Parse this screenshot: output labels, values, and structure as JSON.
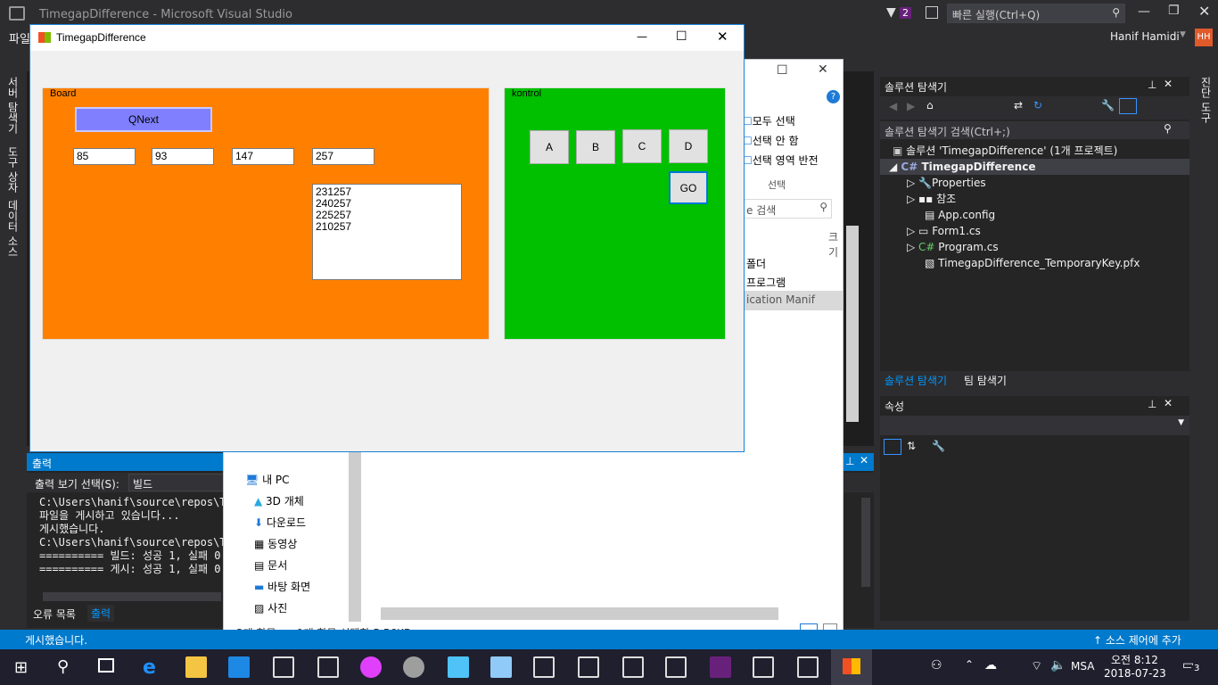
{
  "vs": {
    "title": "TimegapDifference - Microsoft Visual Studio",
    "notif_count": "2",
    "quick_launch": "빠른 실행(Ctrl+Q)",
    "menu_file": "파일",
    "user": "Hanif Hamidi",
    "user_initials": "HH",
    "left_tabs": [
      "서버 탐색기",
      "도구 상자",
      "데이터 소스"
    ],
    "right_tab": "진단 도구",
    "status": "게시했습니다.",
    "source_control": "소스 제어에 추가"
  },
  "output": {
    "title": "출력",
    "show_label": "출력 보기 선택(S):",
    "show_value": "빌드",
    "lines": [
      "C:\\Users\\hanif\\source\\repos\\Ti",
      "파일을 게시하고 있습니다...",
      "게시했습니다.",
      "C:\\Users\\hanif\\source\\repos\\Ti",
      "========== 빌드: 성공 1, 실패 0",
      "========== 게시: 성공 1, 실패 0"
    ],
    "tab_errors": "오류 목록",
    "tab_output": "출력"
  },
  "solution": {
    "title": "솔루션 탐색기",
    "search": "솔루션 탐색기 검색(Ctrl+;)",
    "items": [
      "솔루션 'TimegapDifference' (1개 프로젝트)",
      "TimegapDifference",
      "Properties",
      "참조",
      "App.config",
      "Form1.cs",
      "Program.cs",
      "TimegapDifference_TemporaryKey.pfx"
    ],
    "tab_solution": "솔루션 탐색기",
    "tab_team": "팀 탐색기"
  },
  "properties": {
    "title": "속성"
  },
  "explorer": {
    "select_all": "모두 선택",
    "select_none": "선택 안 함",
    "invert": "선택 영역 반전",
    "group_label": "선택",
    "search": "e 검색",
    "col_size": "크기",
    "rows": [
      "폴더",
      "프로그램",
      "ication Manif"
    ],
    "nav": [
      "내 PC",
      "3D 개체",
      "다운로드",
      "동영상",
      "문서",
      "바탕 화면",
      "사진"
    ],
    "status_count": "3개 항목",
    "status_sel": "1개 항목 선택함 5.56KB"
  },
  "form": {
    "title": "TimegapDifference",
    "board_label": "Board",
    "qnext_label": "QNext",
    "inputs": [
      "85",
      "93",
      "147",
      "257"
    ],
    "list": [
      "231257",
      "240257",
      "225257",
      "210257"
    ],
    "kontrol_label": "kontrol",
    "buttons": [
      "A",
      "B",
      "C",
      "D"
    ],
    "go_label": "GO",
    "colors": {
      "board": "#ff8000",
      "kontrol": "#00c000",
      "qnext": "#8080ff"
    }
  },
  "tray": {
    "ime": "MSA",
    "time": "오전 8:12",
    "date": "2018-07-23",
    "notif": "3"
  }
}
